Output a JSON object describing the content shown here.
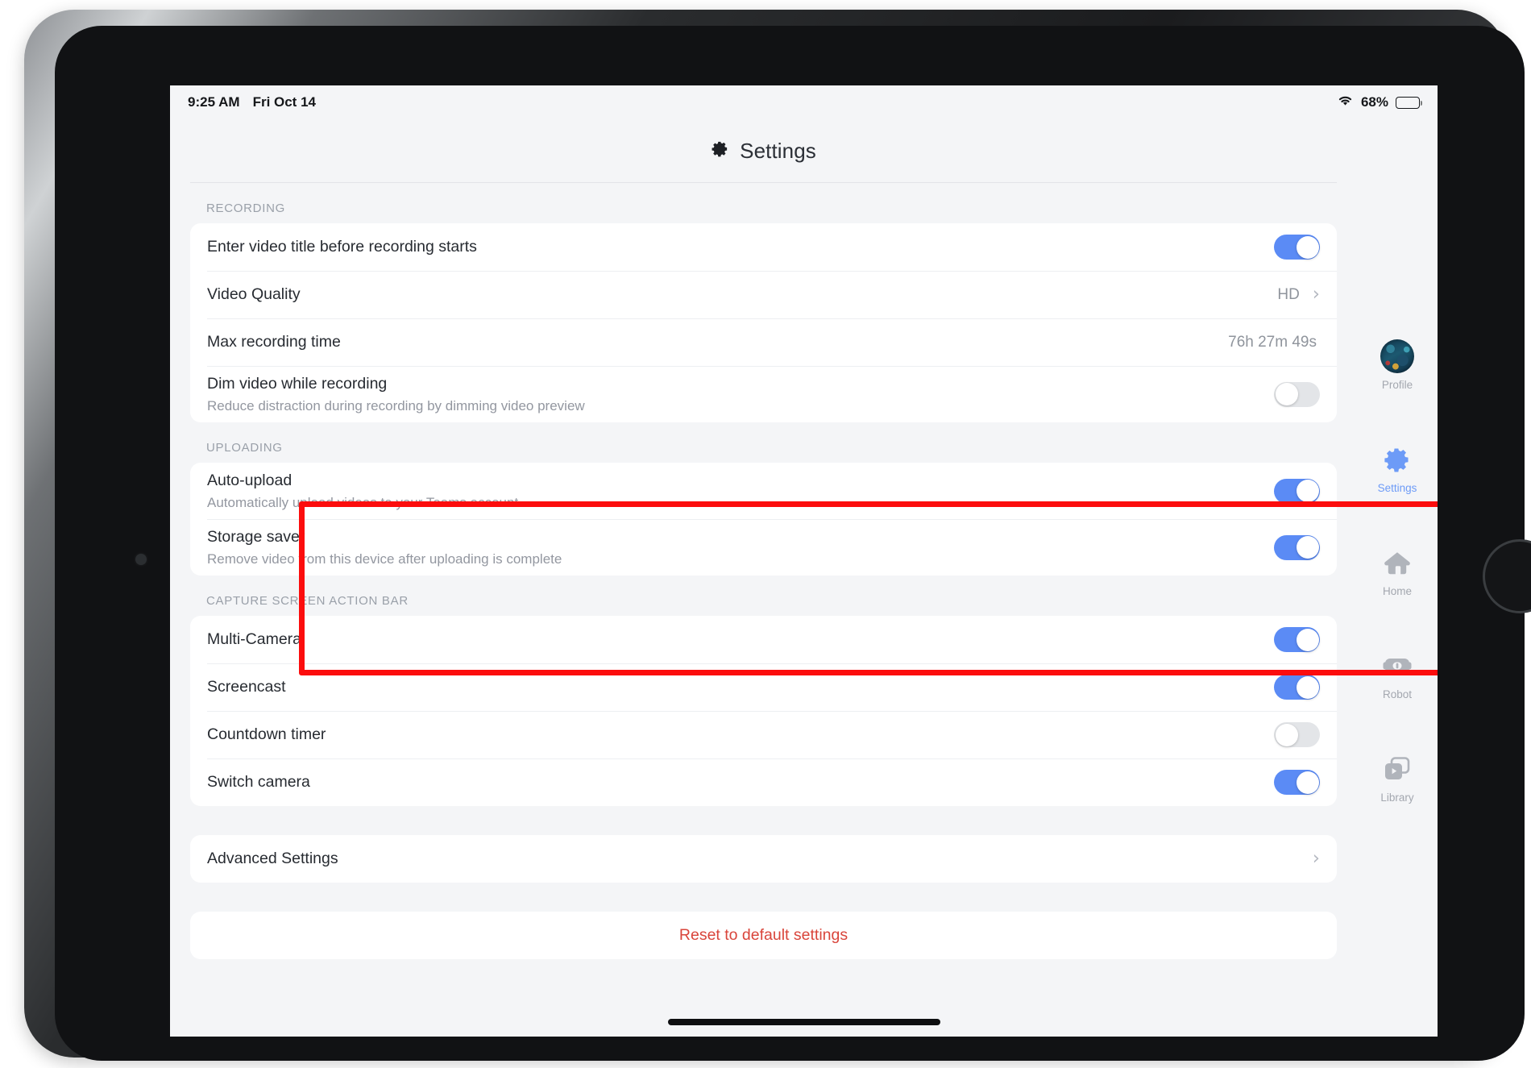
{
  "status_bar": {
    "time": "9:25 AM",
    "date": "Fri Oct 14",
    "wifi_icon": "wifi-icon",
    "battery_percent": "68%",
    "battery_icon": "battery-icon",
    "battery_level": 68
  },
  "header": {
    "title": "Settings",
    "icon": "gear-icon"
  },
  "sections": [
    {
      "id": "recording",
      "header": "RECORDING",
      "rows": [
        {
          "title": "Enter video title before recording starts",
          "sub": "",
          "control": "toggle",
          "state": "on"
        },
        {
          "title": "Video Quality",
          "sub": "",
          "control": "value-chevron",
          "value": "HD"
        },
        {
          "title": "Max recording time",
          "sub": "",
          "control": "value",
          "value": "76h 27m 49s"
        },
        {
          "title": "Dim video while recording",
          "sub": "Reduce distraction during recording by dimming video preview",
          "control": "toggle",
          "state": "off"
        }
      ]
    },
    {
      "id": "uploading",
      "header": "UPLOADING",
      "highlighted": true,
      "rows": [
        {
          "title": "Auto-upload",
          "sub": "Automatically upload videos to your Teams account",
          "control": "toggle",
          "state": "on"
        },
        {
          "title": "Storage saver",
          "sub": "Remove video from this device after uploading is complete",
          "control": "toggle",
          "state": "on"
        }
      ]
    },
    {
      "id": "capture-screen-action-bar",
      "header": "CAPTURE SCREEN ACTION BAR",
      "rows": [
        {
          "title": "Multi-Camera",
          "sub": "",
          "control": "toggle",
          "state": "on"
        },
        {
          "title": "Screencast",
          "sub": "",
          "control": "toggle",
          "state": "on"
        },
        {
          "title": "Countdown timer",
          "sub": "",
          "control": "toggle",
          "state": "off"
        },
        {
          "title": "Switch camera",
          "sub": "",
          "control": "toggle",
          "state": "on"
        }
      ]
    }
  ],
  "advanced": {
    "label": "Advanced Settings",
    "chevron": "chevron-right-icon"
  },
  "reset": {
    "label": "Reset to default settings"
  },
  "dock": {
    "items": [
      {
        "label": "Profile",
        "icon": "avatar-icon",
        "active": false
      },
      {
        "label": "Settings",
        "icon": "gear-icon",
        "active": true
      },
      {
        "label": "Home",
        "icon": "home-icon",
        "active": false
      },
      {
        "label": "Robot",
        "icon": "robot-icon",
        "active": false
      },
      {
        "label": "Library",
        "icon": "library-icon",
        "active": false
      }
    ]
  },
  "colors": {
    "toggle_on": "#5b8bf5",
    "toggle_off": "#e3e5e8",
    "accent": "#6d9bf7",
    "destructive": "#d9453b",
    "highlight_box": "#fc0d0d",
    "screen_bg": "#f4f5f7",
    "card_bg": "#ffffff"
  }
}
